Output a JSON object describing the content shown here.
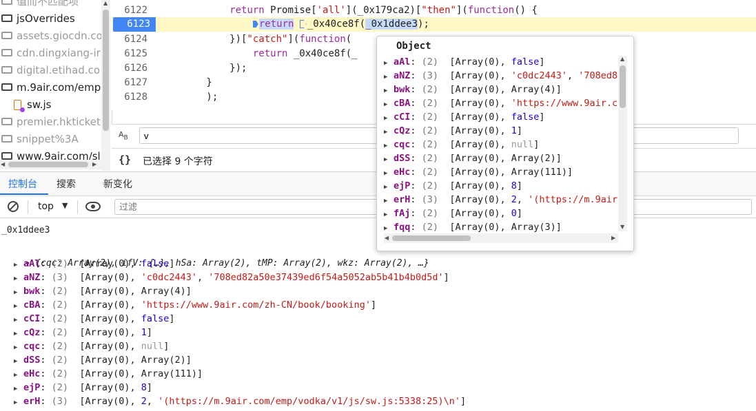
{
  "tree": {
    "items": [
      {
        "label": "值而不匹配项",
        "type": "folder",
        "dim": true
      },
      {
        "label": "jsOverrides",
        "type": "folder",
        "dim": false
      },
      {
        "label": "assets.giocdn.co",
        "type": "folder",
        "dim": true
      },
      {
        "label": "cdn.dingxiang-ir",
        "type": "folder",
        "dim": true
      },
      {
        "label": "digital.etihad.co",
        "type": "folder",
        "dim": true
      },
      {
        "label": "m.9air.com/emp",
        "type": "folder",
        "dim": false
      },
      {
        "label": "sw.js",
        "type": "file",
        "dim": false
      },
      {
        "label": "premier.hkticket",
        "type": "folder",
        "dim": true
      },
      {
        "label": "snippet%3A",
        "type": "folder",
        "dim": true
      },
      {
        "label": "www.9air.com/sl",
        "type": "folder",
        "dim": false
      }
    ]
  },
  "editor": {
    "lines": [
      {
        "num": "6122",
        "text": "            return Promise['all'](_0x179ca2)[\"then\"](function() {"
      },
      {
        "num": "6123",
        "text": "                return _0x40ce8f(_0x1ddee3);",
        "current": true
      },
      {
        "num": "6124",
        "text": "            })[\"catch\"](function("
      },
      {
        "num": "6125",
        "text": "                return _0x40ce8f(_"
      },
      {
        "num": "6126",
        "text": "            });"
      },
      {
        "num": "6127",
        "text": "        }"
      },
      {
        "num": "6128",
        "text": "        );"
      }
    ],
    "current_parts": {
      "indent": "                ",
      "kw": "return",
      "call": "_0x40ce8f(",
      "arg": "_0x1ddee3",
      "tail": ");"
    }
  },
  "search": {
    "case_label": "AB",
    "value": "v"
  },
  "status": {
    "braces": "{}",
    "text": "已选择 9 个字符"
  },
  "tabs": [
    {
      "label": "控制台",
      "active": true
    },
    {
      "label": "搜索",
      "active": false
    },
    {
      "label": "新变化",
      "active": false
    }
  ],
  "toolbar": {
    "context": "top",
    "filter_placeholder": "过滤"
  },
  "console": {
    "input": "_0x1ddee3",
    "summary": "{cqc: Array(2), ifV: {…}, hSa: Array(2), tMP: Array(2), wkz: Array(2), …}",
    "rows": [
      {
        "key": "aAl",
        "count": "(2)",
        "parts": [
          [
            "t",
            "[Array(0), "
          ],
          [
            "b",
            "false"
          ],
          [
            "t",
            "]"
          ]
        ]
      },
      {
        "key": "aNZ",
        "count": "(3)",
        "parts": [
          [
            "t",
            "[Array(0), "
          ],
          [
            "s",
            "'c0dc2443'"
          ],
          [
            "t",
            ", "
          ],
          [
            "s",
            "'708ed82a50e37439ed6f54a5052ab5b41b4b0d5d'"
          ],
          [
            "t",
            "]"
          ]
        ]
      },
      {
        "key": "bwk",
        "count": "(2)",
        "parts": [
          [
            "t",
            "[Array(0), Array(4)]"
          ]
        ]
      },
      {
        "key": "cBA",
        "count": "(2)",
        "parts": [
          [
            "t",
            "[Array(0), "
          ],
          [
            "s",
            "'https://www.9air.com/zh-CN/book/booking'"
          ],
          [
            "t",
            "]"
          ]
        ]
      },
      {
        "key": "cCI",
        "count": "(2)",
        "parts": [
          [
            "t",
            "[Array(0), "
          ],
          [
            "b",
            "false"
          ],
          [
            "t",
            "]"
          ]
        ]
      },
      {
        "key": "cQz",
        "count": "(2)",
        "parts": [
          [
            "t",
            "[Array(0), "
          ],
          [
            "n",
            "1"
          ],
          [
            "t",
            "]"
          ]
        ]
      },
      {
        "key": "cqc",
        "count": "(2)",
        "parts": [
          [
            "t",
            "[Array(0), "
          ],
          [
            "u",
            "null"
          ],
          [
            "t",
            "]"
          ]
        ]
      },
      {
        "key": "dSS",
        "count": "(2)",
        "parts": [
          [
            "t",
            "[Array(0), Array(2)]"
          ]
        ]
      },
      {
        "key": "eHc",
        "count": "(2)",
        "parts": [
          [
            "t",
            "[Array(0), Array(111)]"
          ]
        ]
      },
      {
        "key": "ejP",
        "count": "(2)",
        "parts": [
          [
            "t",
            "[Array(0), "
          ],
          [
            "n",
            "8"
          ],
          [
            "t",
            "]"
          ]
        ]
      },
      {
        "key": "erH",
        "count": "(3)",
        "parts": [
          [
            "t",
            "[Array(0), "
          ],
          [
            "n",
            "2"
          ],
          [
            "t",
            ", "
          ],
          [
            "s",
            "'(https://m.9air.com/emp/vodka/v1/js/sw.js:5338:25)\\n'"
          ],
          [
            "t",
            "]"
          ]
        ]
      }
    ]
  },
  "popover": {
    "title": "Object",
    "rows": [
      {
        "key": "aAl",
        "count": "(2)",
        "parts": [
          [
            "t",
            "[Array(0), "
          ],
          [
            "b",
            "false"
          ],
          [
            "t",
            "]"
          ]
        ]
      },
      {
        "key": "aNZ",
        "count": "(3)",
        "parts": [
          [
            "t",
            "[Array(0), "
          ],
          [
            "s",
            "'c0dc2443'"
          ],
          [
            "t",
            ", "
          ],
          [
            "s",
            "'708ed8"
          ]
        ]
      },
      {
        "key": "bwk",
        "count": "(2)",
        "parts": [
          [
            "t",
            "[Array(0), Array(4)]"
          ]
        ]
      },
      {
        "key": "cBA",
        "count": "(2)",
        "parts": [
          [
            "t",
            "[Array(0), "
          ],
          [
            "s",
            "'https://www.9air.c"
          ]
        ]
      },
      {
        "key": "cCI",
        "count": "(2)",
        "parts": [
          [
            "t",
            "[Array(0), "
          ],
          [
            "b",
            "false"
          ],
          [
            "t",
            "]"
          ]
        ]
      },
      {
        "key": "cQz",
        "count": "(2)",
        "parts": [
          [
            "t",
            "[Array(0), "
          ],
          [
            "n",
            "1"
          ],
          [
            "t",
            "]"
          ]
        ]
      },
      {
        "key": "cqc",
        "count": "(2)",
        "parts": [
          [
            "t",
            "[Array(0), "
          ],
          [
            "u",
            "null"
          ],
          [
            "t",
            "]"
          ]
        ]
      },
      {
        "key": "dSS",
        "count": "(2)",
        "parts": [
          [
            "t",
            "[Array(0), Array(2)]"
          ]
        ]
      },
      {
        "key": "eHc",
        "count": "(2)",
        "parts": [
          [
            "t",
            "[Array(0), Array(111)]"
          ]
        ]
      },
      {
        "key": "ejP",
        "count": "(2)",
        "parts": [
          [
            "t",
            "[Array(0), "
          ],
          [
            "n",
            "8"
          ],
          [
            "t",
            "]"
          ]
        ]
      },
      {
        "key": "erH",
        "count": "(3)",
        "parts": [
          [
            "t",
            "[Array(0), "
          ],
          [
            "n",
            "2"
          ],
          [
            "t",
            ", "
          ],
          [
            "s",
            "'(https://m.9air"
          ]
        ]
      },
      {
        "key": "fAj",
        "count": "(2)",
        "parts": [
          [
            "t",
            "[Array(0), "
          ],
          [
            "n",
            "0"
          ],
          [
            "t",
            "]"
          ]
        ]
      },
      {
        "key": "fqq",
        "count": "(2)",
        "parts": [
          [
            "t",
            "[Array(0), Array(3)]"
          ]
        ]
      }
    ]
  }
}
